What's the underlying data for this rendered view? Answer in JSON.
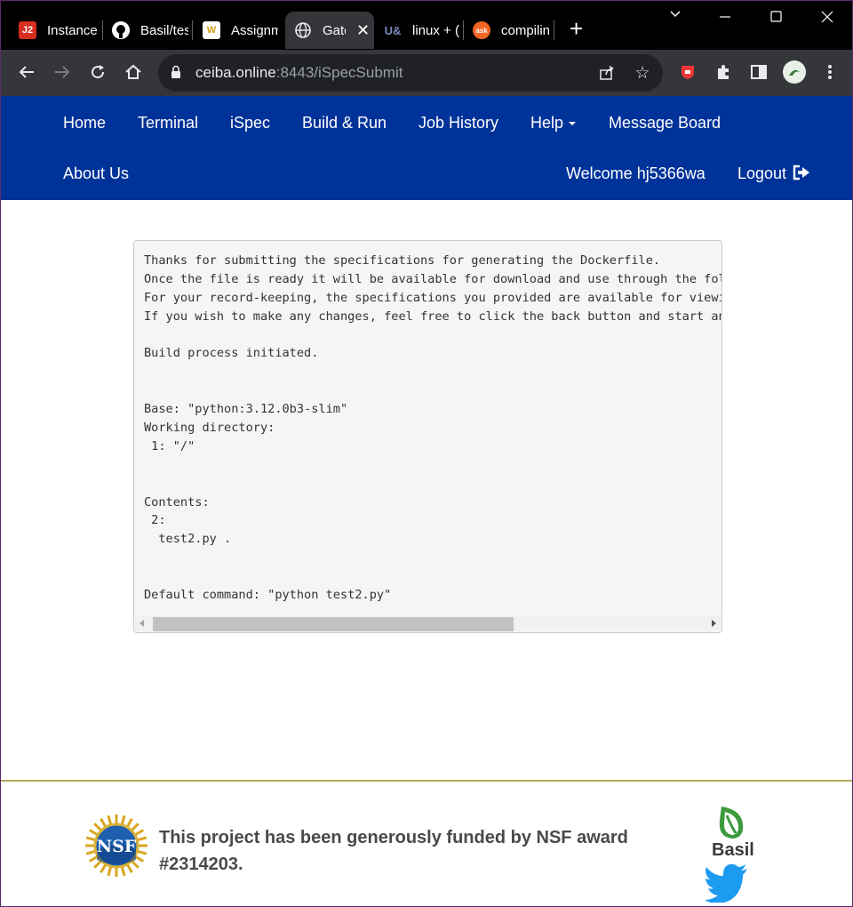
{
  "browser": {
    "tabs": [
      {
        "title": "Instance",
        "favicon": "j2-icon",
        "active": false
      },
      {
        "title": "Basil/tes",
        "favicon": "github-icon",
        "active": false
      },
      {
        "title": "Assignm",
        "favicon": "w-logo-icon",
        "active": false
      },
      {
        "title": "Gate",
        "favicon": "globe-icon",
        "active": true
      },
      {
        "title": "linux + (",
        "favicon": "ud-icon",
        "active": false
      },
      {
        "title": "compilin",
        "favicon": "ask-icon",
        "active": false
      }
    ],
    "url_host": "ceiba.online",
    "url_path": ":8443/iSpecSubmit"
  },
  "navbar": {
    "home": "Home",
    "terminal": "Terminal",
    "ispec": "iSpec",
    "build_run": "Build & Run",
    "job_history": "Job History",
    "help": "Help",
    "message_board": "Message Board",
    "about_us": "About Us",
    "welcome": "Welcome hj5366wa",
    "logout": "Logout"
  },
  "output": {
    "lines": [
      "Thanks for submitting the specifications for generating the Dockerfile.",
      "Once the file is ready it will be available for download and use through the foll",
      "For your record-keeping, the specifications you provided are available for viewin",
      "If you wish to make any changes, feel free to click the back button and start ane",
      "",
      "Build process initiated.",
      "",
      "",
      "Base: \"python:3.12.0b3-slim\"",
      "Working directory:",
      " 1: \"/\"",
      "",
      "",
      "Contents:",
      " 2:",
      "  test2.py .",
      "",
      "",
      "Default command: \"python test2.py\""
    ]
  },
  "footer": {
    "funding_text": "This project has been generously funded by NSF award #2314203.",
    "nsf_logo_text": "NSF",
    "basil_label": "Basil"
  },
  "colors": {
    "navbar_bg": "#003399",
    "footer_rule": "#b8a95a",
    "basil_green": "#3c9a3c",
    "twitter_blue": "#1d9bf0"
  }
}
